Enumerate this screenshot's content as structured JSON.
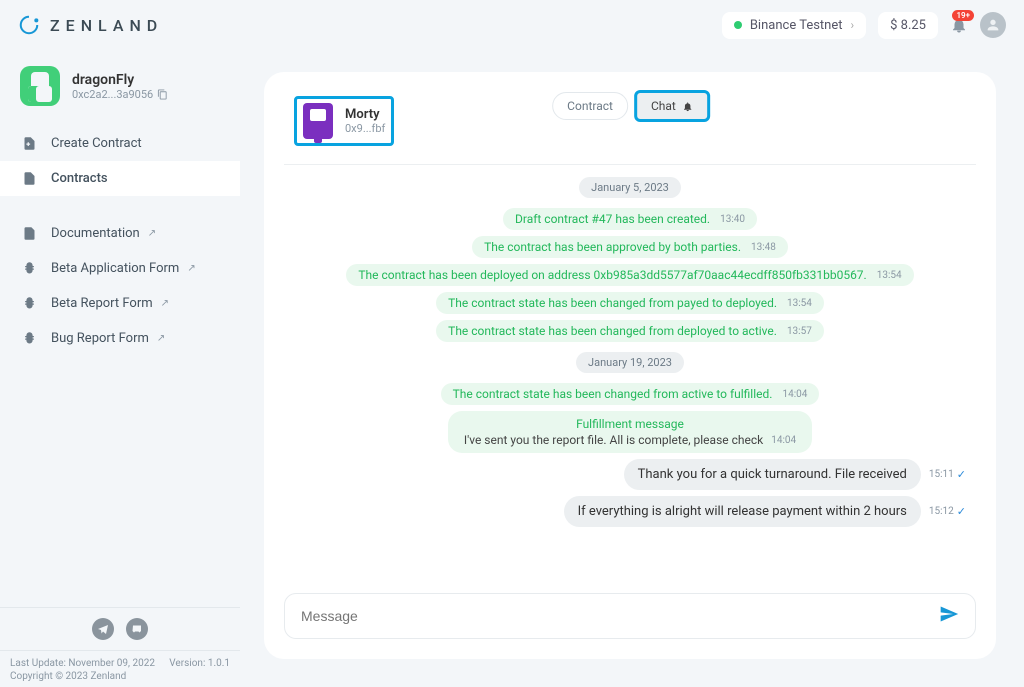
{
  "brand": "ZENLAND",
  "header": {
    "network": "Binance Testnet",
    "balance": "$ 8.25",
    "notif_count": "19+"
  },
  "user": {
    "name": "dragonFly",
    "address": "0xc2a2...3a9056"
  },
  "nav": {
    "create": "Create Contract",
    "contracts": "Contracts",
    "docs": "Documentation",
    "beta_app": "Beta Application Form",
    "beta_report": "Beta Report Form",
    "bug_report": "Bug Report Form"
  },
  "footer": {
    "updated_label": "Last Update:",
    "updated": "November 09, 2022",
    "version_label": "Version:",
    "version": "1.0.1",
    "copyright": "Copyright © 2023 Zenland"
  },
  "tabs": {
    "contract": "Contract",
    "chat": "Chat"
  },
  "party": {
    "name": "Morty",
    "address": "0x9...fbf"
  },
  "chat": {
    "date1": "January 5, 2023",
    "s1": "Draft contract #47 has been created.",
    "t1": "13:40",
    "s2": "The contract has been approved by both parties.",
    "t2": "13:48",
    "s3": "The contract has been deployed on address 0xb985a3dd5577af70aac44ecdff850fb331bb0567.",
    "t3": "13:54",
    "s4": "The contract state has been changed from payed to deployed.",
    "t4": "13:54",
    "s5": "The contract state has been changed from deployed to active.",
    "t5": "13:57",
    "date2": "January 19, 2023",
    "s6": "The contract state has been changed from active to fulfilled.",
    "t6": "14:04",
    "fulfill_title": "Fulfillment message",
    "fulfill_body": "I've sent you the report file. All is complete, please check",
    "t7": "14:04",
    "m1": "Thank you for a quick turnaround. File received",
    "mt1": "15:11",
    "m2": "If everything is alright will release payment within 2 hours",
    "mt2": "15:12"
  },
  "composer": {
    "placeholder": "Message"
  }
}
